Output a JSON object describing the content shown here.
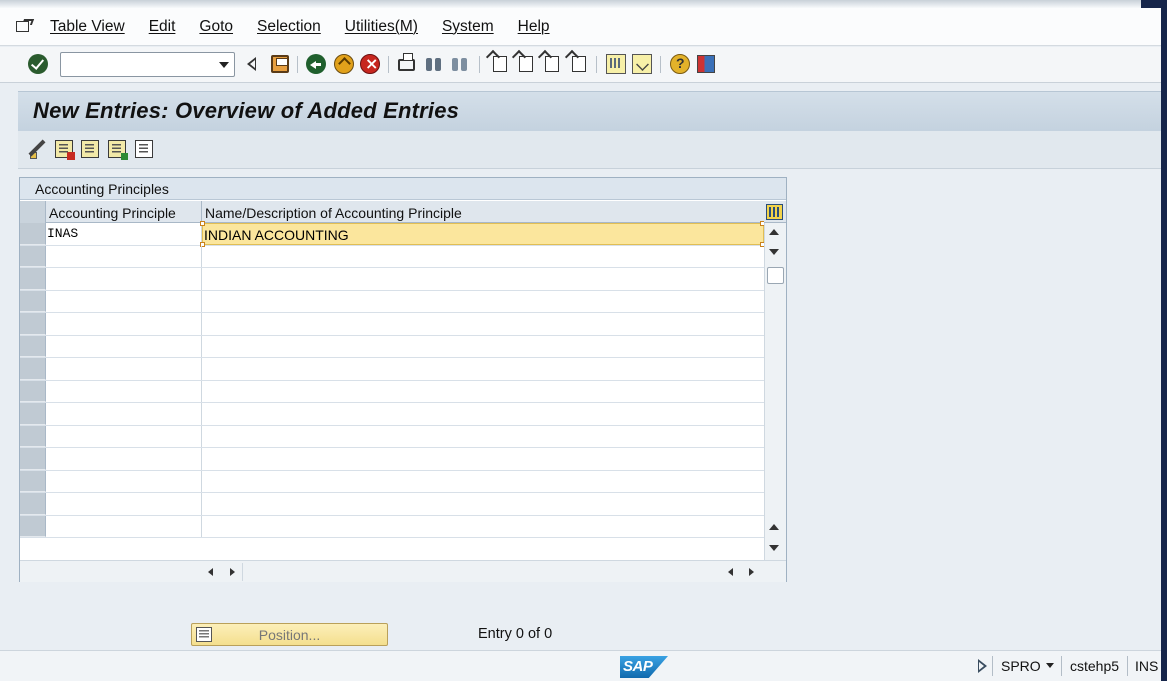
{
  "menu": {
    "items": [
      "Table View",
      "Edit",
      "Goto",
      "Selection",
      "Utilities(M)",
      "System",
      "Help"
    ]
  },
  "toolbar": {
    "command_field_value": "",
    "icons": [
      "enter-icon",
      "back-triangle-icon",
      "save-icon",
      "back-icon",
      "exit-icon",
      "cancel-icon",
      "print-icon",
      "find-icon",
      "find-next-icon",
      "first-page-icon",
      "previous-page-icon",
      "next-page-icon",
      "last-page-icon",
      "create-session-icon",
      "shortcut-icon",
      "help-icon",
      "layout-icon"
    ]
  },
  "screen": {
    "title": "New Entries: Overview of Added Entries"
  },
  "app_toolbar": {
    "icons": [
      "change-display-icon",
      "delete-icon",
      "select-all-icon",
      "select-block-icon",
      "deselect-all-icon"
    ]
  },
  "table": {
    "section_title": "Accounting Principles",
    "columns": [
      "Accounting Principle",
      "Name/Description of Accounting Principle"
    ],
    "rows": [
      {
        "principle": "INAS",
        "description": "INDIAN ACCOUNTING"
      },
      {
        "principle": "",
        "description": ""
      },
      {
        "principle": "",
        "description": ""
      },
      {
        "principle": "",
        "description": ""
      },
      {
        "principle": "",
        "description": ""
      },
      {
        "principle": "",
        "description": ""
      },
      {
        "principle": "",
        "description": ""
      },
      {
        "principle": "",
        "description": ""
      },
      {
        "principle": "",
        "description": ""
      },
      {
        "principle": "",
        "description": ""
      },
      {
        "principle": "",
        "description": ""
      },
      {
        "principle": "",
        "description": ""
      },
      {
        "principle": "",
        "description": ""
      },
      {
        "principle": "",
        "description": ""
      }
    ]
  },
  "footer": {
    "position_button": "Position...",
    "entry_count": "Entry 0 of 0"
  },
  "status": {
    "logo": "SAP",
    "transaction": "SPRO",
    "server": "cstehp5",
    "mode": "INS"
  },
  "colors": {
    "selected_row": "#fbe69d",
    "title_band": "#c4d2df",
    "window_frame": "#16254a"
  }
}
